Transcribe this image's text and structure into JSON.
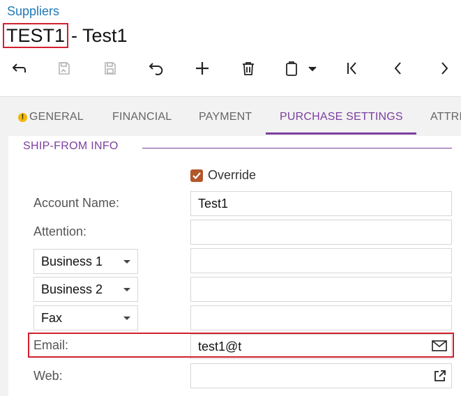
{
  "breadcrumb": "Suppliers",
  "title": {
    "key": "TEST1",
    "rest": "- Test1"
  },
  "toolbar": {
    "icons": [
      "back-icon",
      "save-and-close-icon",
      "save-icon",
      "undo-icon",
      "add-icon",
      "delete-icon",
      "copy-paste-icon",
      "first-record-icon",
      "previous-record-icon",
      "next-record-icon"
    ]
  },
  "tabs": [
    {
      "label": "GENERAL",
      "warning": true
    },
    {
      "label": "FINANCIAL"
    },
    {
      "label": "PAYMENT"
    },
    {
      "label": "PURCHASE SETTINGS",
      "active": true
    },
    {
      "label": "ATTRI"
    }
  ],
  "section": {
    "title": "SHIP-FROM INFO"
  },
  "override": {
    "label": "Override",
    "checked": true
  },
  "form": {
    "account_name_label": "Account Name:",
    "account_name_value": "Test1",
    "attention_label": "Attention:",
    "attention_value": "",
    "phone1_type": "Business 1",
    "phone1_value": "",
    "phone2_type": "Business 2",
    "phone2_value": "",
    "fax_type": "Fax",
    "fax_value": "",
    "email_label": "Email:",
    "email_value": "test1@t",
    "web_label": "Web:",
    "web_value": ""
  },
  "colors": {
    "accent": "#7b3fa0",
    "link": "#1f7ab8",
    "highlight": "#d0202e",
    "checkbox": "#b2572a"
  }
}
